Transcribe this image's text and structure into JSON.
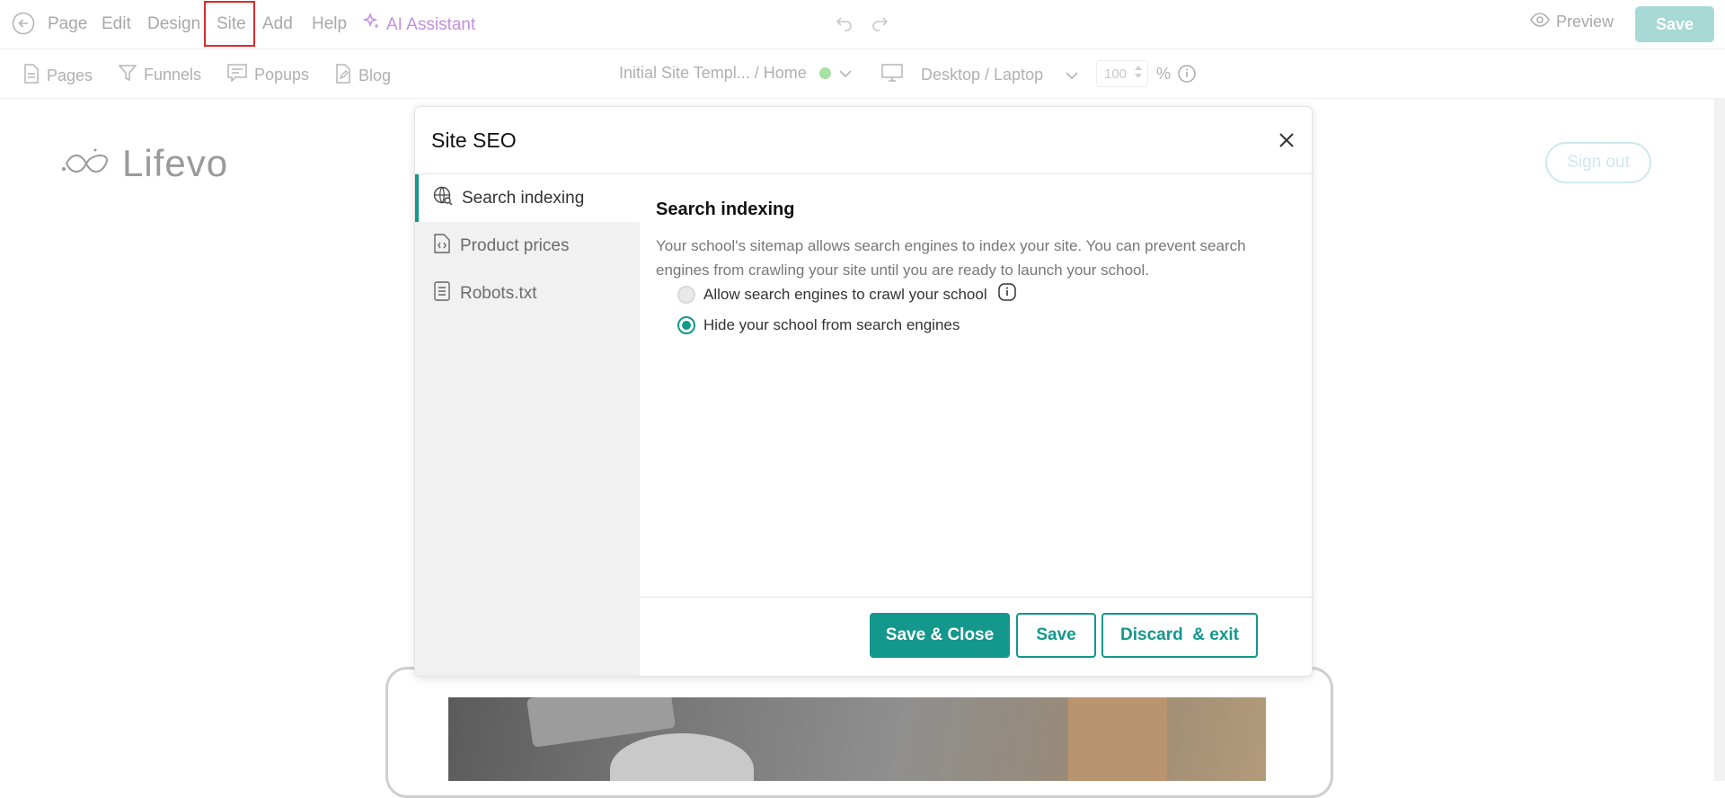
{
  "menu": {
    "items": [
      "Page",
      "Edit",
      "Design",
      "Site",
      "Add",
      "Help"
    ],
    "ai_label": "AI Assistant",
    "preview_label": "Preview",
    "save_label": "Save"
  },
  "toolbar": {
    "pages": "Pages",
    "funnels": "Funnels",
    "popups": "Popups",
    "blog": "Blog",
    "page_selector": "Initial Site Templ... / Home",
    "device": "Desktop / Laptop",
    "zoom_value": "100",
    "zoom_unit": "%"
  },
  "site": {
    "logo_text": "Lifevo",
    "signout_label": "Sign out"
  },
  "modal": {
    "title": "Site SEO",
    "tabs": [
      {
        "label": "Search indexing",
        "icon": "globe-search-icon"
      },
      {
        "label": "Product prices",
        "icon": "code-file-icon"
      },
      {
        "label": "Robots.txt",
        "icon": "document-icon"
      }
    ],
    "section_title": "Search indexing",
    "description": "Your school's sitemap allows search engines to index your site. You can prevent search engines from crawling your site until you are ready to launch your school.",
    "options": [
      {
        "label": "Allow search engines to crawl your school",
        "selected": false
      },
      {
        "label": "Hide your school from search engines",
        "selected": true
      }
    ],
    "buttons": {
      "save_close": "Save & Close",
      "save": "Save",
      "discard": "Discard  & exit"
    }
  },
  "colors": {
    "accent": "#14978c",
    "highlight": "#d92b2b",
    "ai": "#c48ee0"
  }
}
